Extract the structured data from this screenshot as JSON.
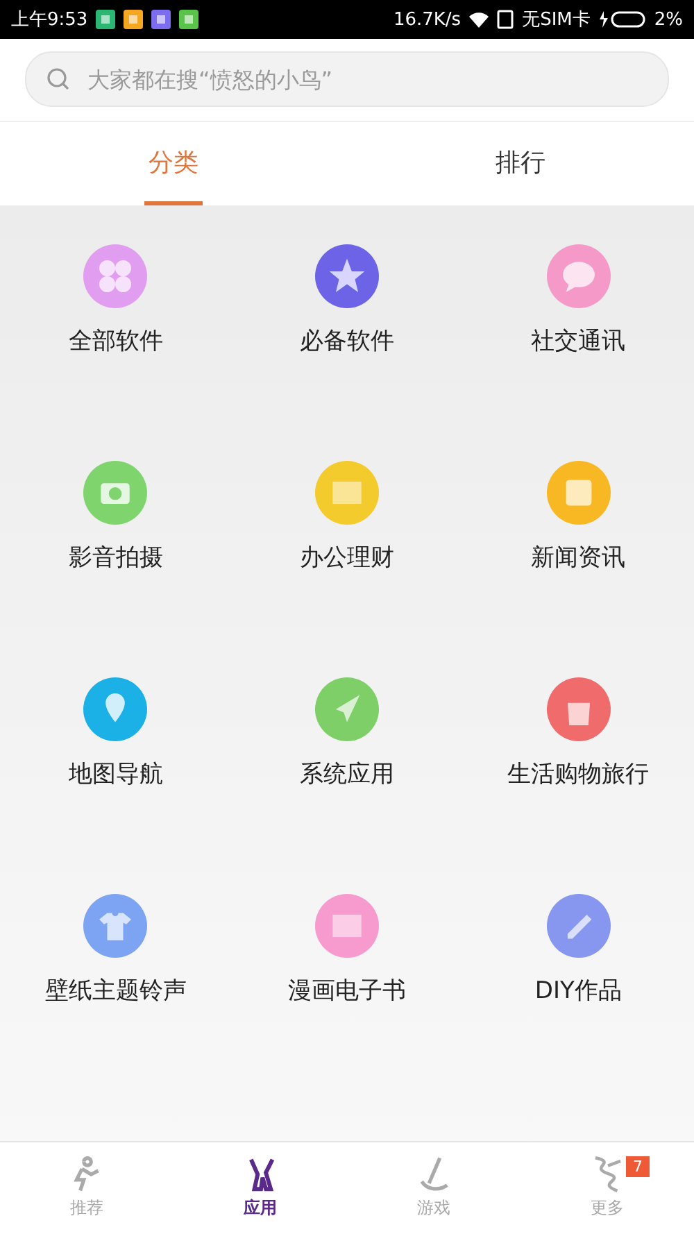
{
  "status_bar": {
    "time": "上午9:53",
    "speed": "16.7K/s",
    "sim": "无SIM卡",
    "battery": "2%"
  },
  "search": {
    "placeholder": "大家都在搜“愤怒的小鸟”"
  },
  "tabs": [
    {
      "label": "分类",
      "selected": true
    },
    {
      "label": "排行",
      "selected": false
    }
  ],
  "categories": [
    {
      "label": "全部软件",
      "color": "#e19ef0"
    },
    {
      "label": "必备软件",
      "color": "#6c63e6"
    },
    {
      "label": "社交通讯",
      "color": "#f59ac8"
    },
    {
      "label": "影音拍摄",
      "color": "#7fd46e"
    },
    {
      "label": "办公理财",
      "color": "#f4cb2c"
    },
    {
      "label": "新闻资讯",
      "color": "#f8b824"
    },
    {
      "label": "地图导航",
      "color": "#1cb1e6"
    },
    {
      "label": "系统应用",
      "color": "#7fcf69"
    },
    {
      "label": "生活购物旅行",
      "color": "#f06b6b"
    },
    {
      "label": "壁纸主题铃声",
      "color": "#7da4f2"
    },
    {
      "label": "漫画电子书",
      "color": "#f79bcf"
    },
    {
      "label": "DIY作品",
      "color": "#8796ee"
    }
  ],
  "bottom_nav": [
    {
      "label": "推荐",
      "selected": false
    },
    {
      "label": "应用",
      "selected": true
    },
    {
      "label": "游戏",
      "selected": false
    },
    {
      "label": "更多",
      "selected": false,
      "badge": "7"
    }
  ]
}
